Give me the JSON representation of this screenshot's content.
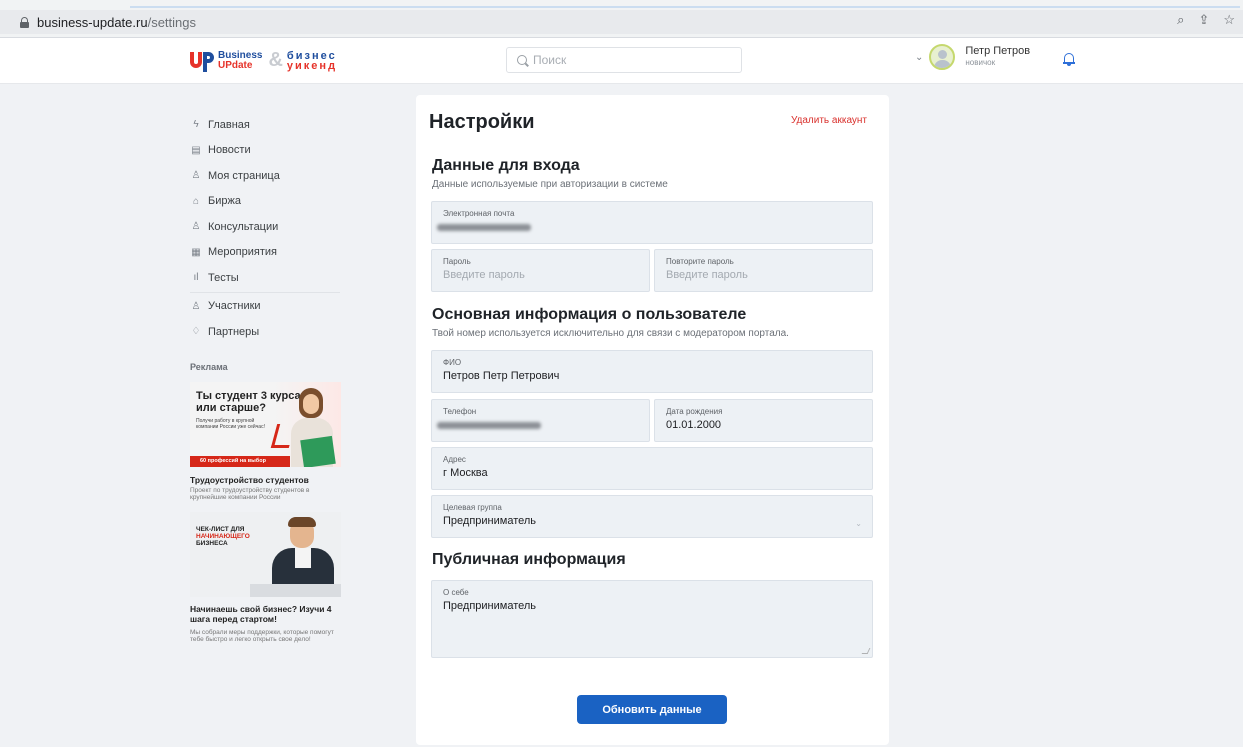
{
  "browser": {
    "url_domain": "business-update.ru",
    "url_path": "/settings"
  },
  "header": {
    "logo_word1": "Business",
    "logo_word2": "UPdate",
    "logo_amp": "&",
    "logo_word3": "бизнес",
    "logo_word4": "уикенд",
    "search_placeholder": "Поиск",
    "user_name": "Петр Петров",
    "user_role": "новичок"
  },
  "nav": {
    "items": [
      {
        "label": "Главная",
        "icon": "lightning-icon",
        "glyph": "ϟ"
      },
      {
        "label": "Новости",
        "icon": "newspaper-icon",
        "glyph": "▤"
      },
      {
        "label": "Моя страница",
        "icon": "user-icon",
        "glyph": "♙"
      },
      {
        "label": "Биржа",
        "icon": "building-icon",
        "glyph": "⌂"
      },
      {
        "label": "Консультации",
        "icon": "person-icon",
        "glyph": "♙"
      },
      {
        "label": "Мероприятия",
        "icon": "calendar-icon",
        "glyph": "▦"
      },
      {
        "label": "Тесты",
        "icon": "bars-icon",
        "glyph": "ıl"
      },
      {
        "label": "Участники",
        "icon": "group-icon",
        "glyph": "♙"
      },
      {
        "label": "Партнеры",
        "icon": "partner-icon",
        "glyph": "♢"
      }
    ]
  },
  "ads": {
    "section_title": "Реклама",
    "ad1": {
      "headline": "Ты студент 3 курса или старше?",
      "small": "Получи работу в крупной компании России уже сейчас!",
      "strip": "60 профессий на выбор",
      "title": "Трудоустройство студентов",
      "desc": "Проект по трудоустройству студентов в крупнейшие компании России"
    },
    "ad2": {
      "headline_line1": "ЧЕК-ЛИСТ ДЛЯ",
      "headline_line2": "НАЧИНАЮЩЕГО",
      "headline_line3": "БИЗНЕСА",
      "title": "Начинаешь свой бизнес? Изучи 4 шага перед стартом!",
      "desc": "Мы собрали меры поддержки, которые помогут тебе быстро и легко открыть свое дело!"
    }
  },
  "settings": {
    "title": "Настройки",
    "delete_account": "Удалить аккаунт",
    "login_section": {
      "title": "Данные для входа",
      "subtitle": "Данные используемые при авторизации в системе",
      "email_label": "Электронная почта",
      "password_label": "Пароль",
      "password_placeholder": "Введите пароль",
      "repeat_label": "Повторите пароль",
      "repeat_placeholder": "Введите пароль"
    },
    "main_section": {
      "title": "Основная информация о пользователе",
      "subtitle": "Твой номер используется исключительно для связи с модератором портала.",
      "fio_label": "ФИО",
      "fio_value": "Петров Петр Петрович",
      "phone_label": "Телефон",
      "birth_label": "Дата рождения",
      "birth_value": "01.01.2000",
      "address_label": "Адрес",
      "address_value": "г Москва",
      "group_label": "Целевая группа",
      "group_value": "Предприниматель"
    },
    "public_section": {
      "title": "Публичная информация",
      "about_label": "О себе",
      "about_value": "Предприниматель"
    },
    "submit_label": "Обновить данные"
  }
}
